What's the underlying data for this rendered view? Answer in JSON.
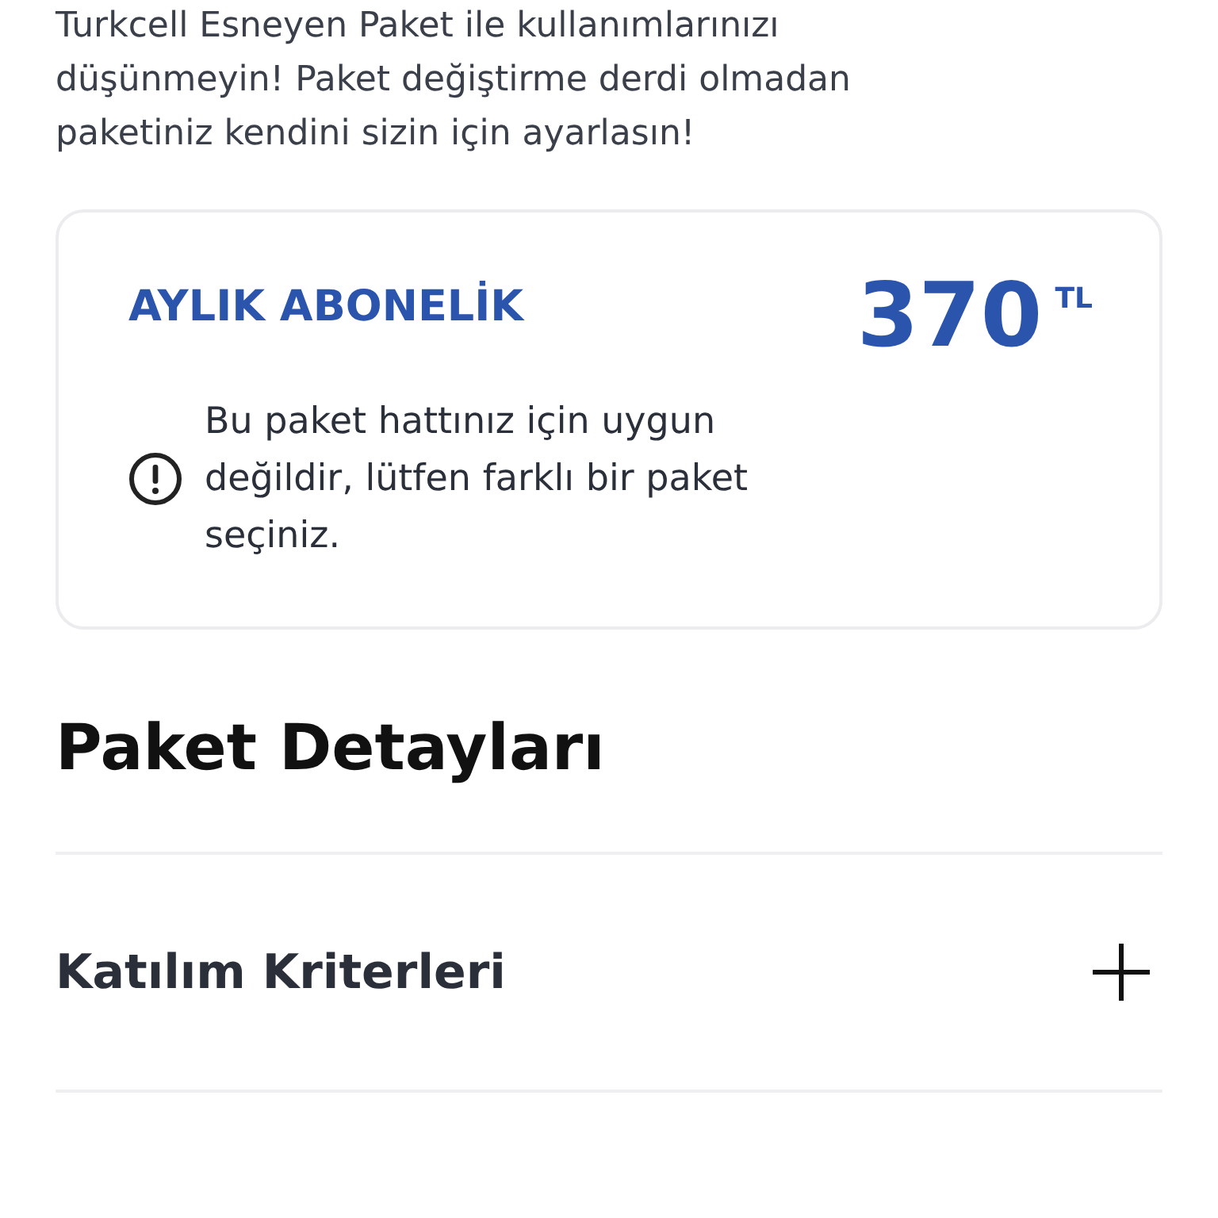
{
  "intro": "Turkcell Esneyen Paket ile kullanımlarınızı düşünmeyin! Paket değiştirme derdi olmadan paketiniz kendini sizin için ayarlasın!",
  "card": {
    "title": "AYLIK ABONELİK",
    "price": "370",
    "currency": "TL",
    "warning": "Bu paket hattınız için uygun değildir, lütfen farklı bir paket seçiniz."
  },
  "section_title": "Paket Detayları",
  "accordion": [
    {
      "label": "Katılım Kriterleri",
      "expanded": false
    }
  ]
}
